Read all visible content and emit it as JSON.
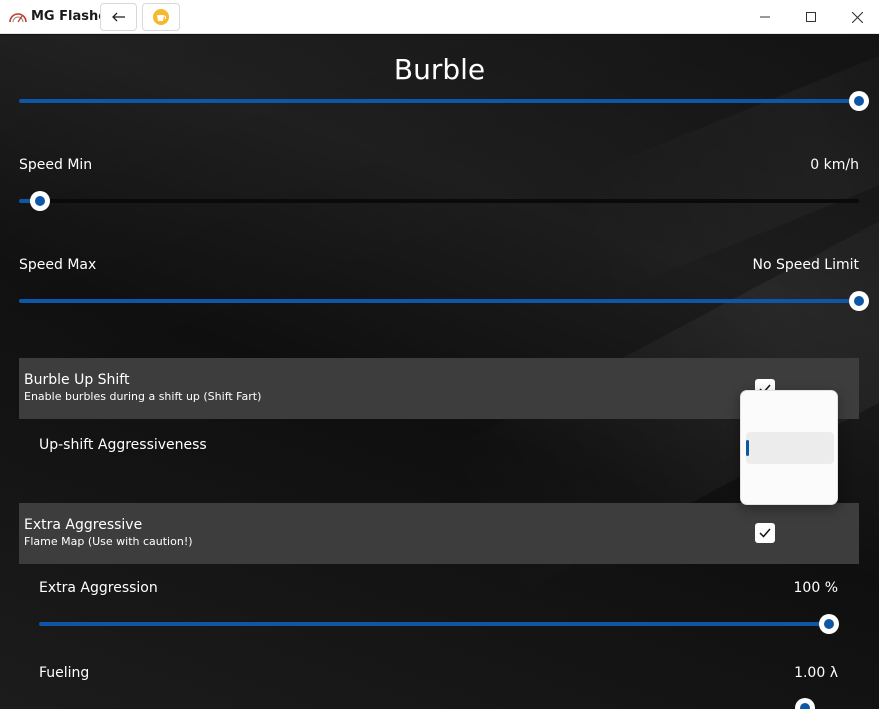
{
  "app": {
    "title": "MG Flasher",
    "icons": {
      "logo": "mg-flasher-logo",
      "back": "arrow-left-icon",
      "bmc": "buy-me-coffee-icon",
      "minimize": "minimize-icon",
      "maximize": "maximize-icon",
      "close": "close-icon"
    }
  },
  "page": {
    "title": "Burble"
  },
  "sliders": {
    "top": {
      "value_fraction": 1.0
    },
    "speed_min": {
      "label": "Speed Min",
      "value": "0 km/h",
      "value_fraction": 0.025
    },
    "speed_max": {
      "label": "Speed Max",
      "value": "No Speed Limit",
      "value_fraction": 1.0
    },
    "extra_aggression": {
      "label": "Extra Aggression",
      "value": "100 %",
      "value_fraction": 1.0
    },
    "fueling": {
      "label": "Fueling",
      "value": "1.00 λ"
    }
  },
  "sections": {
    "burble_up_shift": {
      "title": "Burble Up Shift",
      "description": "Enable burbles during a shift up (Shift Fart)",
      "checked": true
    },
    "upshift_aggressiveness": {
      "label": "Up-shift Aggressiveness"
    },
    "extra_aggressive": {
      "title": "Extra Aggressive",
      "description": "Flame Map (Use with caution!)",
      "checked": true
    }
  },
  "colors": {
    "accent": "#0e57a6",
    "section_bg": "#3d3d3d",
    "text": "#ffffff"
  }
}
